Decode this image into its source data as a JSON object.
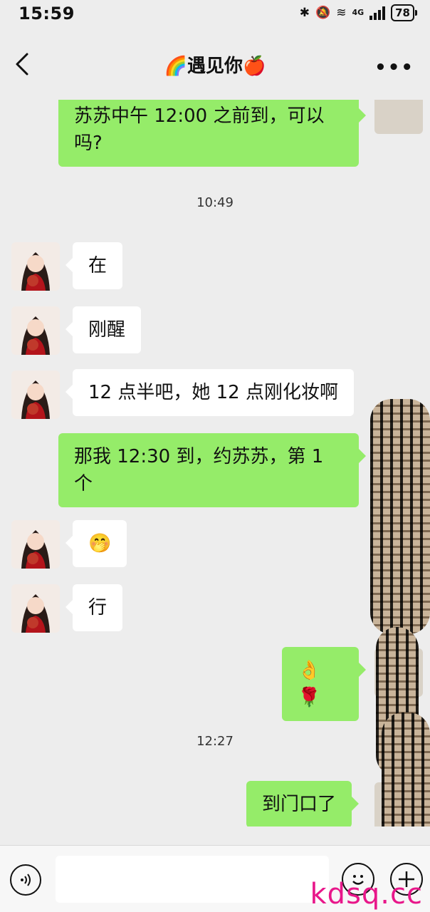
{
  "status": {
    "time": "15:59",
    "network": "4G",
    "battery": "78"
  },
  "header": {
    "title": "🌈遇见你🍎"
  },
  "messages": [
    {
      "side": "out",
      "text": "苏苏中午 12:00 之前到，可以吗?"
    },
    {
      "timestamp": "10:49"
    },
    {
      "side": "in",
      "text": "在"
    },
    {
      "side": "in",
      "text": "刚醒"
    },
    {
      "side": "in",
      "text": "12 点半吧，她 12 点刚化妆啊"
    },
    {
      "side": "out",
      "text": "那我 12:30 到，约苏苏，第 1 个"
    },
    {
      "side": "in",
      "text": "🤭"
    },
    {
      "side": "in",
      "text": "行"
    },
    {
      "side": "out",
      "text": "👌🌹"
    },
    {
      "timestamp": "12:27"
    },
    {
      "side": "out",
      "text": "到门口了"
    }
  ],
  "input": {
    "placeholder": ""
  },
  "icons": {
    "back": "back-chevron-icon",
    "more": "more-dots-icon",
    "voice": "voice-icon",
    "emoji": "emoji-icon",
    "plus": "plus-icon"
  },
  "colors": {
    "background": "#ededed",
    "outgoing_bubble": "#95ec69",
    "incoming_bubble": "#ffffff",
    "watermark": "#e8178a"
  },
  "watermark": "kdsq.cc"
}
